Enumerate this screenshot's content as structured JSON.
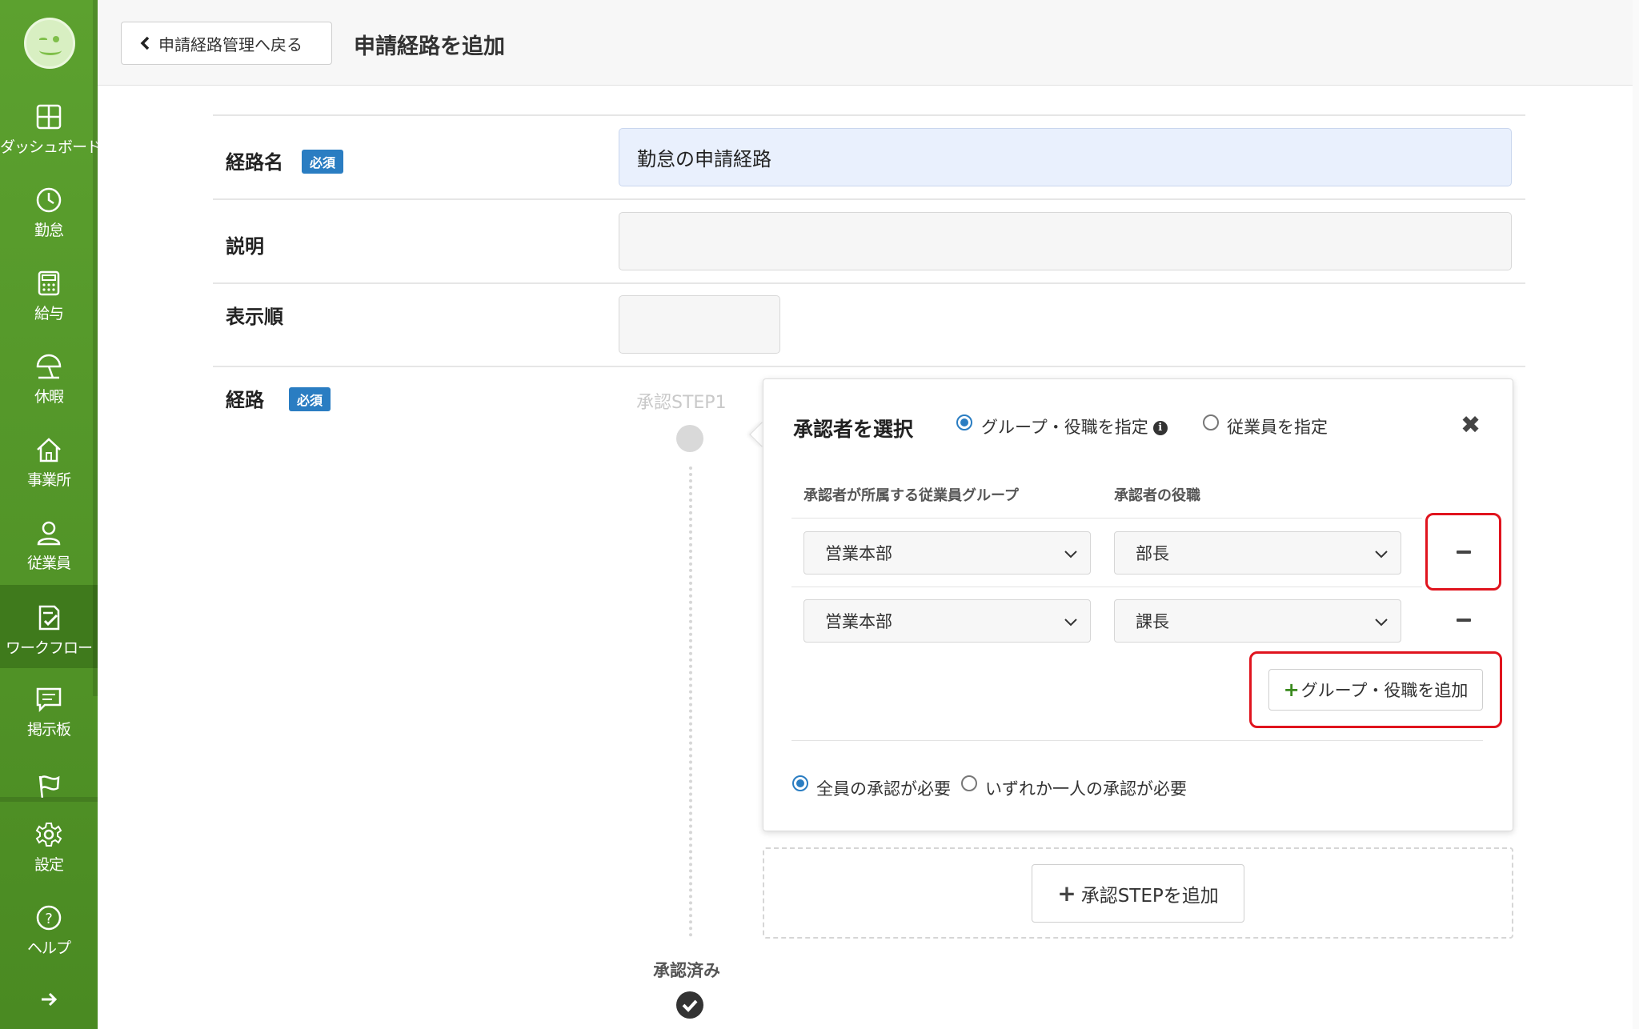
{
  "sidebar": {
    "items": [
      {
        "label": "ダッシュボード",
        "icon": "dashboard-icon"
      },
      {
        "label": "勤怠",
        "icon": "clock-icon"
      },
      {
        "label": "給与",
        "icon": "calculator-icon"
      },
      {
        "label": "休暇",
        "icon": "umbrella-icon"
      },
      {
        "label": "事業所",
        "icon": "home-icon"
      },
      {
        "label": "従業員",
        "icon": "person-icon"
      },
      {
        "label": "ワークフロー",
        "icon": "checklist-icon"
      },
      {
        "label": "掲示板",
        "icon": "message-icon"
      },
      {
        "label": "",
        "icon": "flag-icon"
      },
      {
        "label": "設定",
        "icon": "gear-icon"
      },
      {
        "label": "ヘルプ",
        "icon": "help-icon"
      }
    ],
    "active_index": 6,
    "colors": {
      "bg": "#5ca12f",
      "active": "#3f7a1c"
    }
  },
  "header": {
    "back_label": "申請経路管理へ戻る",
    "title": "申請経路を追加"
  },
  "form": {
    "route_name": {
      "label": "経路名",
      "badge": "必須",
      "value": "勤怠の申請経路"
    },
    "description": {
      "label": "説明",
      "value": ""
    },
    "display_order": {
      "label": "表示順",
      "value": ""
    },
    "route": {
      "label": "経路",
      "badge": "必須"
    }
  },
  "timeline": {
    "step_label": "承認STEP1",
    "done_label": "承認済み"
  },
  "panel": {
    "title": "承認者を選択",
    "mode_options": [
      {
        "label": "グループ・役職を指定",
        "selected": true
      },
      {
        "label": "従業員を指定",
        "selected": false
      }
    ],
    "col_group": "承認者が所属する従業員グループ",
    "col_role": "承認者の役職",
    "rows": [
      {
        "group": "営業本部",
        "role": "部長"
      },
      {
        "group": "営業本部",
        "role": "課長"
      }
    ],
    "add_group_label": "グループ・役職を追加",
    "approval_options": [
      {
        "label": "全員の承認が必要",
        "selected": true
      },
      {
        "label": "いずれか一人の承認が必要",
        "selected": false
      }
    ]
  },
  "add_step_label": "承認STEPを追加",
  "colors": {
    "accent": "#2a7dc2",
    "highlight": "#e0141e",
    "brand_green": "#5ca12f"
  }
}
